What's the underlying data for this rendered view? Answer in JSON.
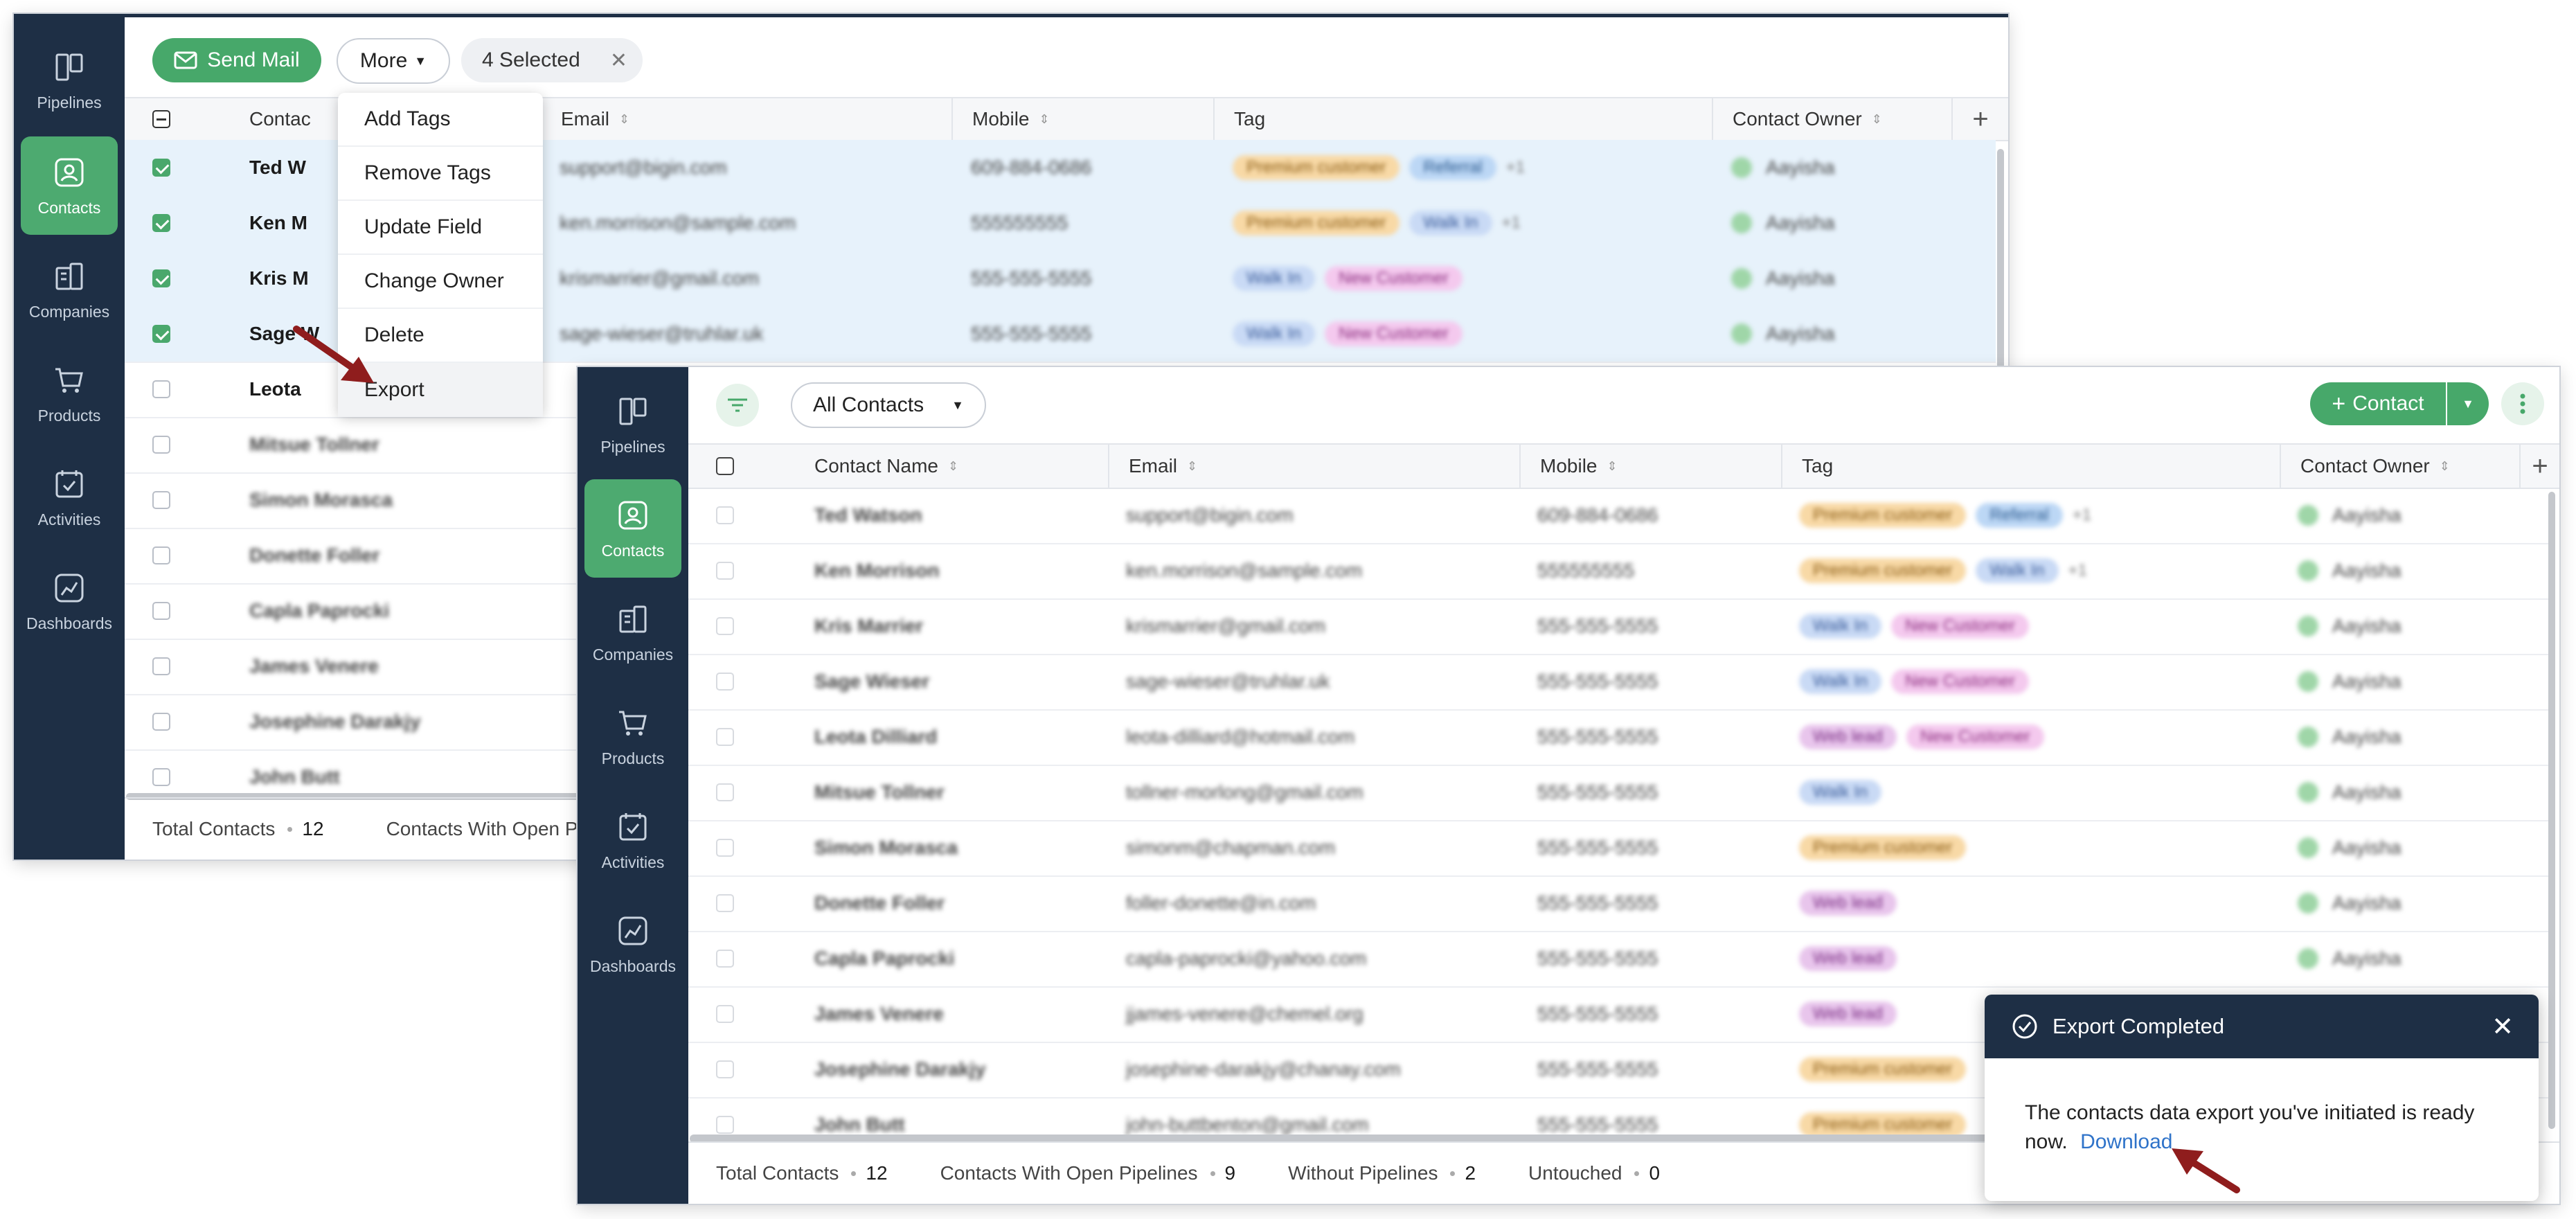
{
  "sidebar": {
    "items": [
      {
        "label": "Pipelines"
      },
      {
        "label": "Contacts"
      },
      {
        "label": "Companies"
      },
      {
        "label": "Products"
      },
      {
        "label": "Activities"
      },
      {
        "label": "Dashboards"
      }
    ]
  },
  "back_window": {
    "send_mail_label": "Send Mail",
    "more_label": "More",
    "selected_label": "4 Selected",
    "columns": [
      "Contact Name",
      "Email",
      "Mobile",
      "Tag",
      "Contact Owner"
    ],
    "column_visible": [
      "Contac",
      "Email",
      "Mobile",
      "Tag",
      "Contact Owner"
    ],
    "rows": [
      {
        "name": "Ted W",
        "email": "support@bigin.com",
        "mobile": "609-884-0686",
        "tags": [
          "Premium customer",
          "Referral"
        ],
        "more": "+1",
        "owner": "Aayisha",
        "checked": true
      },
      {
        "name": "Ken M",
        "email": "ken.morrison@sample.com",
        "mobile": "555555555",
        "tags": [
          "Premium customer",
          "Walk In"
        ],
        "more": "+1",
        "owner": "Aayisha",
        "checked": true
      },
      {
        "name": "Kris M",
        "email": "krismarrier@gmail.com",
        "mobile": "555-555-5555",
        "tags": [
          "Walk In",
          "New Customer"
        ],
        "more": "",
        "owner": "Aayisha",
        "checked": true
      },
      {
        "name": "Sage W",
        "email": "sage-wieser@truhlar.uk",
        "mobile": "555-555-5555",
        "tags": [
          "Walk In",
          "New Customer"
        ],
        "more": "",
        "owner": "Aayisha",
        "checked": true
      },
      {
        "name": "Leota",
        "email": "",
        "mobile": "",
        "tags": [],
        "more": "",
        "owner": "",
        "checked": false
      },
      {
        "name": "Mitsue Tollner",
        "email": "",
        "mobile": "",
        "tags": [],
        "more": "",
        "owner": "",
        "checked": false
      },
      {
        "name": "Simon Morasca",
        "email": "",
        "mobile": "",
        "tags": [],
        "more": "",
        "owner": "",
        "checked": false
      },
      {
        "name": "Donette Foller",
        "email": "",
        "mobile": "",
        "tags": [],
        "more": "",
        "owner": "",
        "checked": false
      },
      {
        "name": "Capla Paprocki",
        "email": "",
        "mobile": "",
        "tags": [],
        "more": "",
        "owner": "",
        "checked": false
      },
      {
        "name": "James Venere",
        "email": "",
        "mobile": "",
        "tags": [],
        "more": "",
        "owner": "",
        "checked": false
      },
      {
        "name": "Josephine Darakjy",
        "email": "",
        "mobile": "",
        "tags": [],
        "more": "",
        "owner": "",
        "checked": false
      },
      {
        "name": "John Butt",
        "email": "",
        "mobile": "",
        "tags": [],
        "more": "",
        "owner": "",
        "checked": false
      }
    ],
    "footer": {
      "total_label": "Total Contacts",
      "total_value": "12",
      "open_label": "Contacts With Open Pi"
    }
  },
  "more_menu": {
    "items": [
      "Add Tags",
      "Remove Tags",
      "Update Field",
      "Change Owner",
      "Delete",
      "Export"
    ]
  },
  "front_window": {
    "view_label": "All Contacts",
    "add_contact_label": "Contact",
    "columns": [
      "Contact Name",
      "Email",
      "Mobile",
      "Tag",
      "Contact Owner"
    ],
    "rows": [
      {
        "name": "Ted Watson",
        "email": "support@bigin.com",
        "mobile": "609-884-0686",
        "tags": [
          "Premium customer",
          "Referral"
        ],
        "more": "+1",
        "owner": "Aayisha"
      },
      {
        "name": "Ken Morrison",
        "email": "ken.morrison@sample.com",
        "mobile": "555555555",
        "tags": [
          "Premium customer",
          "Walk In"
        ],
        "more": "+1",
        "owner": "Aayisha"
      },
      {
        "name": "Kris Marrier",
        "email": "krismarrier@gmail.com",
        "mobile": "555-555-5555",
        "tags": [
          "Walk In",
          "New Customer"
        ],
        "more": "",
        "owner": "Aayisha"
      },
      {
        "name": "Sage Wieser",
        "email": "sage-wieser@truhlar.uk",
        "mobile": "555-555-5555",
        "tags": [
          "Walk In",
          "New Customer"
        ],
        "more": "",
        "owner": "Aayisha"
      },
      {
        "name": "Leota Dilliard",
        "email": "leota-dilliard@hotmail.com",
        "mobile": "555-555-5555",
        "tags": [
          "Web lead",
          "New Customer"
        ],
        "more": "",
        "owner": "Aayisha"
      },
      {
        "name": "Mitsue Tollner",
        "email": "tollner-morlong@gmail.com",
        "mobile": "555-555-5555",
        "tags": [
          "Walk In"
        ],
        "more": "",
        "owner": "Aayisha"
      },
      {
        "name": "Simon Morasca",
        "email": "simonm@chapman.com",
        "mobile": "555-555-5555",
        "tags": [
          "Premium customer"
        ],
        "more": "",
        "owner": "Aayisha"
      },
      {
        "name": "Donette Foller",
        "email": "foller-donette@in.com",
        "mobile": "555-555-5555",
        "tags": [
          "Web lead"
        ],
        "more": "",
        "owner": "Aayisha"
      },
      {
        "name": "Capla Paprocki",
        "email": "capla-paprocki@yahoo.com",
        "mobile": "555-555-5555",
        "tags": [
          "Web lead"
        ],
        "more": "",
        "owner": "Aayisha"
      },
      {
        "name": "James Venere",
        "email": "jjames-venere@chemel.org",
        "mobile": "555-555-5555",
        "tags": [
          "Web lead"
        ],
        "more": "",
        "owner": "Aayisha"
      },
      {
        "name": "Josephine Darakjy",
        "email": "josephine-darakjy@chanay.com",
        "mobile": "555-555-5555",
        "tags": [
          "Premium customer"
        ],
        "more": "",
        "owner": "Aayisha"
      },
      {
        "name": "John Butt",
        "email": "john-buttbenton@gmail.com",
        "mobile": "555-555-5555",
        "tags": [
          "Premium customer"
        ],
        "more": "",
        "owner": "Aayisha"
      }
    ],
    "footer": {
      "total_label": "Total Contacts",
      "total_value": "12",
      "open_label": "Contacts With Open Pipelines",
      "open_value": "9",
      "without_label": "Without Pipelines",
      "without_value": "2",
      "untouched_label": "Untouched",
      "untouched_value": "0"
    }
  },
  "toast": {
    "title": "Export Completed",
    "message": "The contacts data export you've initiated is ready now.",
    "link_label": "Download"
  },
  "icons": {
    "pipelines": "pipelines-icon",
    "contacts": "contacts-icon",
    "companies": "companies-icon",
    "products": "products-icon",
    "activities": "activities-icon",
    "dashboards": "dashboards-icon",
    "filter": "filter-icon",
    "mail": "mail-icon",
    "close": "close-icon",
    "plus": "plus-icon",
    "kebab": "kebab-icon",
    "check-circle": "check-circle-icon",
    "arrow": "pointer-arrow-icon"
  },
  "colors": {
    "sidebar": "#1e2f45",
    "accent_green": "#47a86a",
    "selected_row": "#e7f2fb",
    "link": "#2f73c9"
  }
}
